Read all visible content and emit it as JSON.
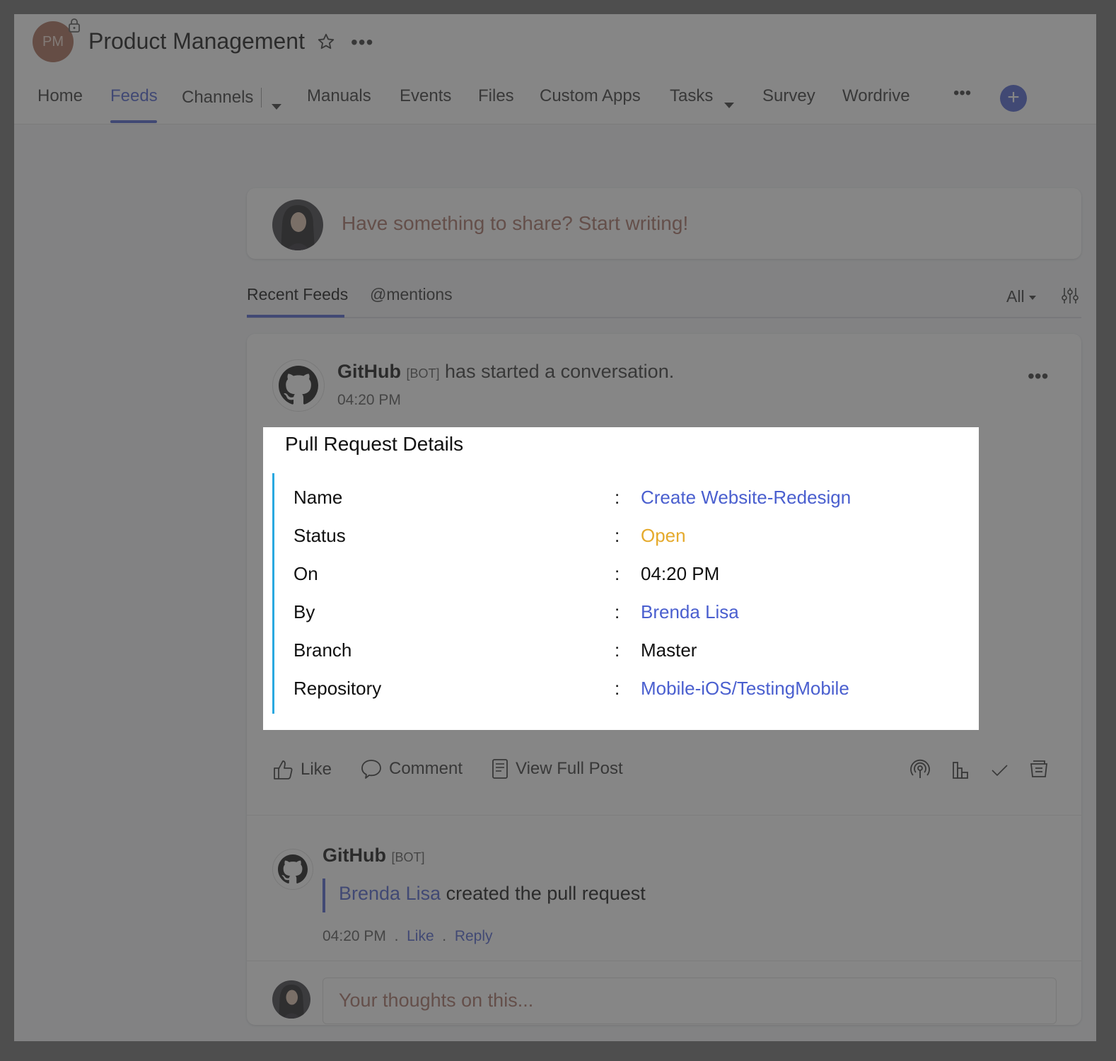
{
  "header": {
    "avatar_initials": "PM",
    "title": "Product Management"
  },
  "nav": {
    "items": [
      "Home",
      "Feeds",
      "Channels",
      "Manuals",
      "Events",
      "Files",
      "Custom Apps",
      "Tasks",
      "Survey",
      "Wordrive"
    ],
    "active": "Feeds"
  },
  "compose": {
    "placeholder": "Have something to share? Start writing!"
  },
  "feed_tabs": {
    "recent": "Recent Feeds",
    "mentions": "@mentions",
    "filter": "All"
  },
  "post": {
    "author": "GitHub",
    "bot_tag": "[BOT]",
    "action": "has started a conversation.",
    "time": "04:20 PM",
    "card": {
      "title": "Pull Request Details",
      "rows": [
        {
          "label": "Name",
          "value": "Create Website-Redesign",
          "style": "link"
        },
        {
          "label": "Status",
          "value": "Open",
          "style": "open"
        },
        {
          "label": "On",
          "value": "04:20 PM",
          "style": "plain"
        },
        {
          "label": "By",
          "value": "Brenda Lisa",
          "style": "link"
        },
        {
          "label": "Branch",
          "value": "Master",
          "style": "plain"
        },
        {
          "label": "Repository",
          "value": "Mobile-iOS/TestingMobile",
          "style": "link"
        }
      ]
    },
    "actions": {
      "like": "Like",
      "comment": "Comment",
      "view": "View Full Post"
    }
  },
  "comment": {
    "author": "GitHub",
    "bot_tag": "[BOT]",
    "user": "Brenda Lisa",
    "text": "created the pull request",
    "time": "04:20 PM",
    "like": "Like",
    "reply": "Reply"
  },
  "reply_box": {
    "placeholder": "Your thoughts on this..."
  },
  "colors": {
    "accent": "#4a5fcf",
    "status_open": "#e5aa2c",
    "quote_bar": "#29a8e0"
  },
  "icons": [
    "lock-icon",
    "star-icon",
    "more-icon",
    "add-icon",
    "filter-icon",
    "github-icon",
    "like-icon",
    "comment-icon",
    "view-post-icon",
    "broadcast-icon",
    "chart-icon",
    "check-icon",
    "archive-icon"
  ]
}
